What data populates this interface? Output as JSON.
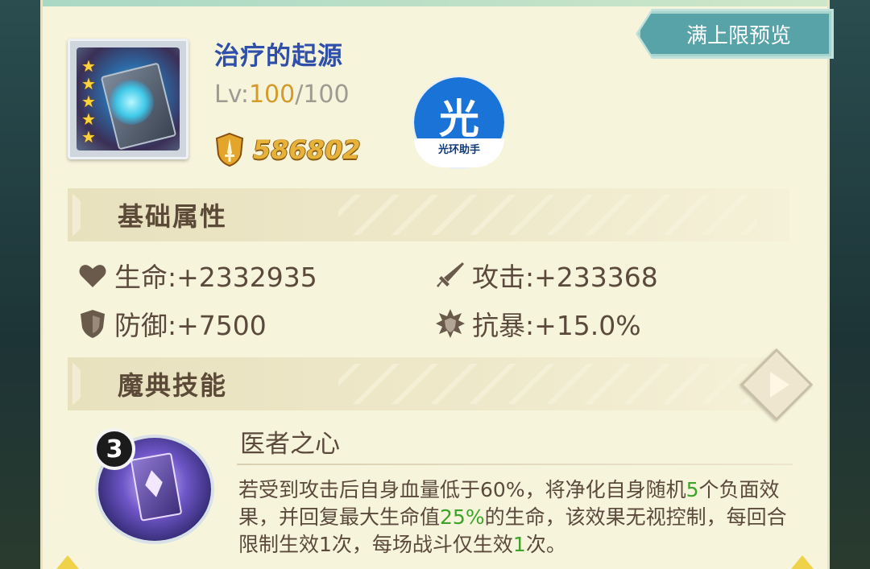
{
  "header": {
    "preview_button": "满上限预览"
  },
  "item": {
    "name": "治疗的起源",
    "level_prefix": "Lv:",
    "level_current": "100",
    "level_max": "/100",
    "stars": 5,
    "power": "586802",
    "power_icon": "sword-shield-icon"
  },
  "watermark": {
    "glyph": "光",
    "text": "光环助手"
  },
  "basic_attributes": {
    "title": "基础属性",
    "stats": [
      {
        "icon": "heart-icon",
        "text": "生命:+2332935"
      },
      {
        "icon": "sword-icon",
        "text": "攻击:+233368"
      },
      {
        "icon": "shield-icon",
        "text": "防御:+7500"
      },
      {
        "icon": "crit-resist-icon",
        "text": "抗暴:+15.0%"
      }
    ]
  },
  "skills": {
    "title": "魔典技能",
    "arrow_icon": "play-arrow-icon",
    "skill": {
      "level": "3",
      "name": "医者之心",
      "desc_1": "若受到攻击后自身血量低于60%，将净化自身随机",
      "desc_hl_1": "5",
      "desc_2": "个负面效果，并回复最大生命值",
      "desc_hl_2": "25%",
      "desc_3": "的生命，该效果无视控制，每回合限制生效1次，每场战斗仅生效",
      "desc_hl_3": "1",
      "desc_4": "次。"
    }
  },
  "colors": {
    "panel_bg": "#f7f4dc",
    "title_blue": "#2f4fa8",
    "level_orange": "#d49a2a",
    "power_gold": "#e6b23a",
    "text_brown": "#5b4a3c",
    "highlight_green": "#3fa22a",
    "button_teal": "#57a3a8"
  }
}
